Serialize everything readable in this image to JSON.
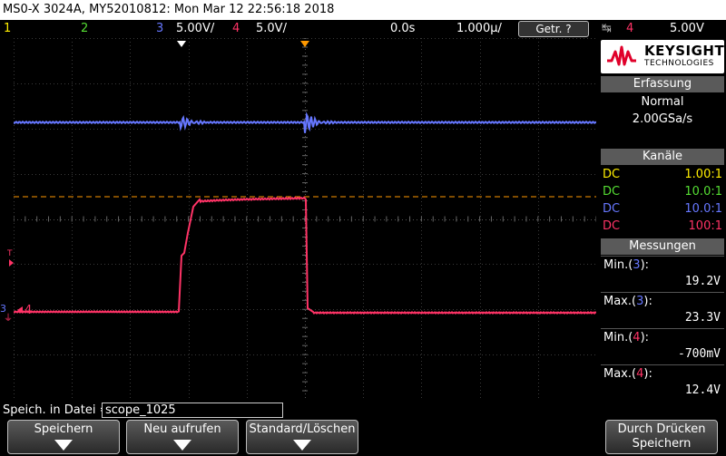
{
  "header": {
    "title": "MS0-X 3024A, MY52010812: Mon Mar 12 22:56:18 2018"
  },
  "status": {
    "ch1": "1",
    "ch2": "2",
    "ch3": "3",
    "ch3_scale": "5.00V/",
    "ch4": "4",
    "ch4_scale": "5.0V/",
    "time_pos": "0.0s",
    "time_scale": "1.000µ/",
    "trigger_button": "Getr.",
    "trigger_button_symbol": "?",
    "trigger_channel": "4",
    "trigger_level": "5.00V"
  },
  "plot": {
    "marker_t": "T",
    "ch4_marker": "4",
    "ch3_ground": "3"
  },
  "sidebar": {
    "logo_brand": "KEYSIGHT",
    "logo_sub": "TECHNOLOGIES",
    "acquisition": {
      "title": "Erfassung",
      "mode": "Normal",
      "rate": "2.00GSa/s"
    },
    "channels": {
      "title": "Kanäle",
      "rows": [
        {
          "coupling": "DC",
          "ratio": "1.00:1",
          "color": "#ffee00"
        },
        {
          "coupling": "DC",
          "ratio": "10.0:1",
          "color": "#55dd33"
        },
        {
          "coupling": "DC",
          "ratio": "10.0:1",
          "color": "#6677ff"
        },
        {
          "coupling": "DC",
          "ratio": "100:1",
          "color": "#ff3366"
        }
      ]
    },
    "measurements": {
      "title": "Messungen",
      "items": [
        {
          "label": "Min.(",
          "channel": "3",
          "close": "):",
          "value": "19.2V"
        },
        {
          "label": "Max.(",
          "channel": "3",
          "close": "):",
          "value": "23.3V"
        },
        {
          "label": "Min.(",
          "channel": "4",
          "close": "):",
          "value": "-700mV"
        },
        {
          "label": "Max.(",
          "channel": "4",
          "close": "):",
          "value": "12.4V"
        }
      ]
    }
  },
  "file": {
    "label": "Speich. in Datei =",
    "value": "scope_1025"
  },
  "softkeys": {
    "save": "Speichern",
    "recall": "Neu aufrufen",
    "default": "Standard/Löschen",
    "press_line1": "Durch Drücken",
    "press_line2": "Speichern"
  },
  "colors": {
    "ch1": "#ffee00",
    "ch2": "#55dd33",
    "ch3": "#6677ff",
    "ch4": "#ff3366",
    "trigger_level_line": "#ff9900"
  }
}
